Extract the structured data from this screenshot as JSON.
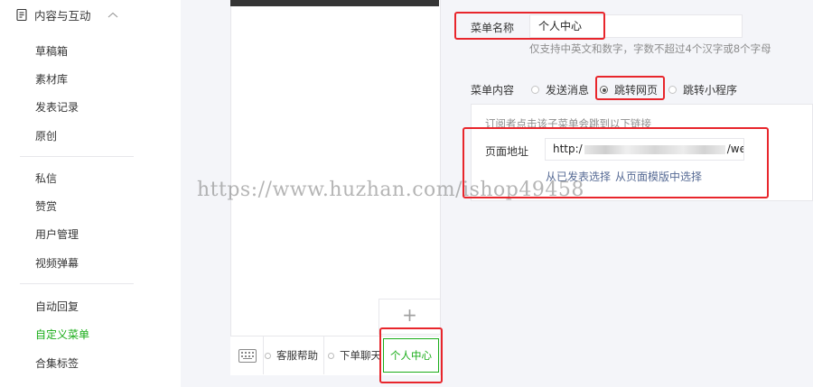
{
  "sidebar": {
    "section_title": "内容与互动",
    "section_icon": "document-icon",
    "collapse_icon": "chevron-up-icon",
    "group1": [
      "草稿箱",
      "素材库",
      "发表记录",
      "原创"
    ],
    "group2": [
      "私信",
      "赞赏",
      "用户管理",
      "视频弹幕"
    ],
    "group3": [
      "自动回复",
      "自定义菜单",
      "合集标签"
    ],
    "active_item": "自定义菜单",
    "accent_color": "#1aad19"
  },
  "preview": {
    "keyboard_icon": "keyboard-icon",
    "menu_tabs": [
      "客服帮助",
      "下单聊天",
      "个人中心"
    ],
    "selected_tab": "个人中心",
    "add_button": "+"
  },
  "editor": {
    "menu_name_label": "菜单名称",
    "menu_name_value": "个人中心",
    "menu_name_hint": "仅支持中英文和数字，字数不超过4个汉字或8个字母",
    "menu_content_label": "菜单内容",
    "options": [
      {
        "label": "发送消息",
        "checked": false
      },
      {
        "label": "跳转网页",
        "checked": true
      },
      {
        "label": "跳转小程序",
        "checked": false
      }
    ],
    "link_desc": "订阅者点击该子菜单会跳到以下链接",
    "page_url_label": "页面地址",
    "url_prefix": "http:/",
    "url_suffix": "/we",
    "choose_from_posts": "从已发表选择",
    "choose_from_templates": "从页面模版中选择"
  },
  "watermark": "https://www.huzhan.com/ishop49458",
  "highlight_color": "#e8262c"
}
